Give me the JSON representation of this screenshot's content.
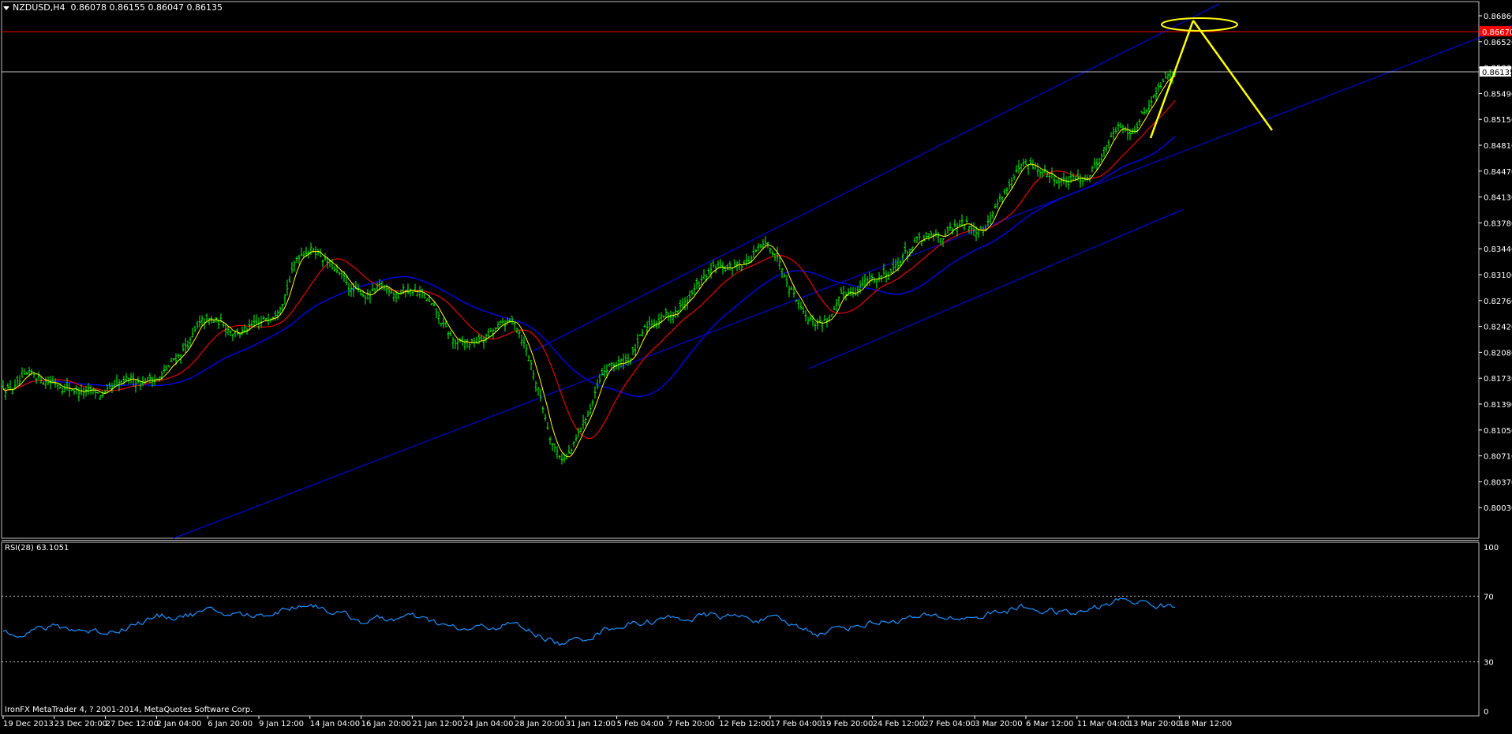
{
  "header": {
    "menu_arrow_icon": "triangle-down-icon",
    "symbol": "NZDUSD,H4",
    "ohlc": "0.86078 0.86155 0.86047 0.86135"
  },
  "indicator": {
    "label": "RSI(28) 63.1051",
    "levels": [
      "100",
      "70",
      "30",
      "0"
    ]
  },
  "footer": {
    "copyright": "IronFX MetaTrader 4, ? 2001-2014, MetaQuotes Software Corp."
  },
  "price_axis": {
    "labels": [
      "0.86860",
      "0.86520",
      "0.85830",
      "0.85490",
      "0.85150",
      "0.84810",
      "0.84470",
      "0.84130",
      "0.83780",
      "0.83440",
      "0.83100",
      "0.82760",
      "0.82420",
      "0.82080",
      "0.81730",
      "0.81390",
      "0.81050",
      "0.80710",
      "0.80370",
      "0.80030"
    ],
    "current_price": "0.86135",
    "resistance_label": "0.86670"
  },
  "time_axis": {
    "labels": [
      "19 Dec 2013",
      "23 Dec 20:00",
      "27 Dec 12:00",
      "2 Jan 04:00",
      "6 Jan 20:00",
      "9 Jan 12:00",
      "14 Jan 04:00",
      "16 Jan 20:00",
      "21 Jan 12:00",
      "24 Jan 04:00",
      "28 Jan 20:00",
      "31 Jan 12:00",
      "5 Feb 04:00",
      "7 Feb 20:00",
      "12 Feb 12:00",
      "17 Feb 04:00",
      "19 Feb 20:00",
      "24 Feb 12:00",
      "27 Feb 04:00",
      "3 Mar 20:00",
      "6 Mar 12:00",
      "11 Mar 04:00",
      "13 Mar 20:00",
      "18 Mar 12:00"
    ]
  },
  "colors": {
    "background": "#000000",
    "bars": "#00ff00",
    "ma_fast": "#ffff00",
    "ma_mid": "#ff0000",
    "ma_slow": "#0000ff",
    "channel": "#0000ff",
    "rsi": "#1e90ff",
    "annotation": "#ffff00",
    "resistance": "#ff0000",
    "price_line": "#c0c0c0"
  },
  "chart_data": {
    "type": "candlestick",
    "symbol": "NZDUSD",
    "timeframe": "H4",
    "x": [
      "19 Dec 2013",
      "23 Dec 20:00",
      "27 Dec 12:00",
      "2 Jan 04:00",
      "6 Jan 20:00",
      "9 Jan 12:00",
      "14 Jan 04:00",
      "16 Jan 20:00",
      "21 Jan 12:00",
      "24 Jan 04:00",
      "28 Jan 20:00",
      "31 Jan 12:00",
      "5 Feb 04:00",
      "7 Feb 20:00",
      "12 Feb 12:00",
      "17 Feb 04:00",
      "19 Feb 20:00",
      "24 Feb 12:00",
      "27 Feb 04:00",
      "3 Mar 20:00",
      "6 Mar 12:00",
      "11 Mar 04:00",
      "13 Mar 20:00",
      "18 Mar 12:00"
    ],
    "price_path": [
      [
        0,
        0.8196
      ],
      [
        1,
        0.8203
      ],
      [
        2,
        0.818
      ],
      [
        3,
        0.8208
      ],
      [
        4,
        0.8275
      ],
      [
        5,
        0.827
      ],
      [
        6,
        0.8385
      ],
      [
        7,
        0.8315
      ],
      [
        8,
        0.8325
      ],
      [
        9,
        0.8245
      ],
      [
        10,
        0.8275
      ],
      [
        11,
        0.8105
      ],
      [
        12,
        0.822
      ],
      [
        13,
        0.829
      ],
      [
        14,
        0.8345
      ],
      [
        15,
        0.8375
      ],
      [
        16,
        0.8285
      ],
      [
        17,
        0.8335
      ],
      [
        18,
        0.8385
      ],
      [
        19,
        0.8405
      ],
      [
        20,
        0.848
      ],
      [
        21,
        0.8465
      ],
      [
        22,
        0.854
      ],
      [
        23,
        0.861
      ]
    ],
    "ylim": [
      0.8003,
      0.8686
    ],
    "current_price": 0.86135,
    "resistance": 0.8667,
    "indicator": {
      "name": "RSI(28)",
      "value": 63.1051,
      "levels": [
        70,
        30
      ],
      "ylim": [
        0,
        100
      ],
      "path": [
        [
          0,
          48
        ],
        [
          1,
          51
        ],
        [
          2,
          48
        ],
        [
          3,
          57
        ],
        [
          4,
          60
        ],
        [
          5,
          58
        ],
        [
          6,
          66
        ],
        [
          7,
          55
        ],
        [
          8,
          57
        ],
        [
          9,
          49
        ],
        [
          10,
          53
        ],
        [
          11,
          40
        ],
        [
          12,
          52
        ],
        [
          13,
          56
        ],
        [
          14,
          58
        ],
        [
          15,
          56
        ],
        [
          16,
          48
        ],
        [
          17,
          54
        ],
        [
          18,
          57
        ],
        [
          19,
          57
        ],
        [
          20,
          63
        ],
        [
          21,
          59
        ],
        [
          22,
          68
        ],
        [
          23,
          63
        ]
      ]
    }
  }
}
